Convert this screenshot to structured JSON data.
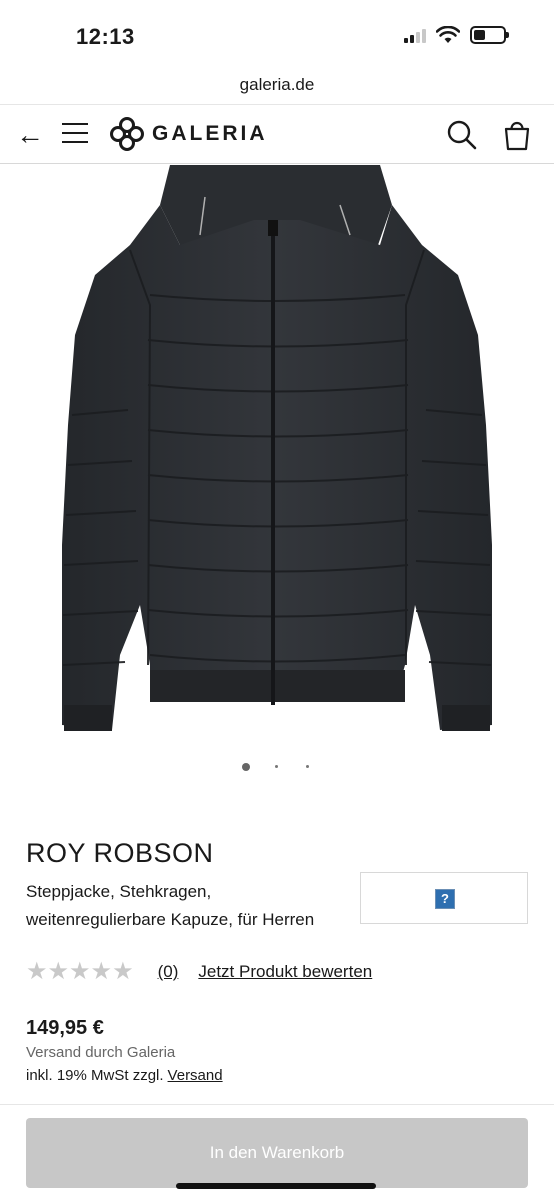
{
  "status_bar": {
    "time": "12:13"
  },
  "browser": {
    "url": "galeria.de"
  },
  "header": {
    "logo_text": "GALERIA",
    "back_symbol": "←"
  },
  "icons": {
    "back": "arrow-left-icon",
    "menu": "hamburger-menu-icon",
    "logo": "galeria-logo-icon",
    "search": "search-icon",
    "bag": "shopping-bag-icon"
  },
  "carousel": {
    "total_images": 3,
    "active_index": 0
  },
  "product": {
    "brand": "ROY ROBSON",
    "description": "Steppjacke, Stehkragen, weitenregulierbare Kapuze, für Herren",
    "rating_stars": "★★★★★",
    "rating_value": 0,
    "rating_count": "(0)",
    "rate_link": "Jetzt Produkt bewerten",
    "price": "149,95 €",
    "shipping_info": "Versand durch Galeria",
    "vat_text": "inkl. 19% MwSt zzgl.",
    "vat_link": "Versand"
  },
  "ad_placeholder": {
    "symbol": "?"
  },
  "actions": {
    "add_to_cart": "In den Warenkorb",
    "add_to_cart_enabled": false
  },
  "colors": {
    "button_disabled": "#c7c7c7",
    "text": "#1a1a1a",
    "muted": "#666666",
    "stars": "#c9c9c9",
    "jacket": "#2b2e33"
  }
}
